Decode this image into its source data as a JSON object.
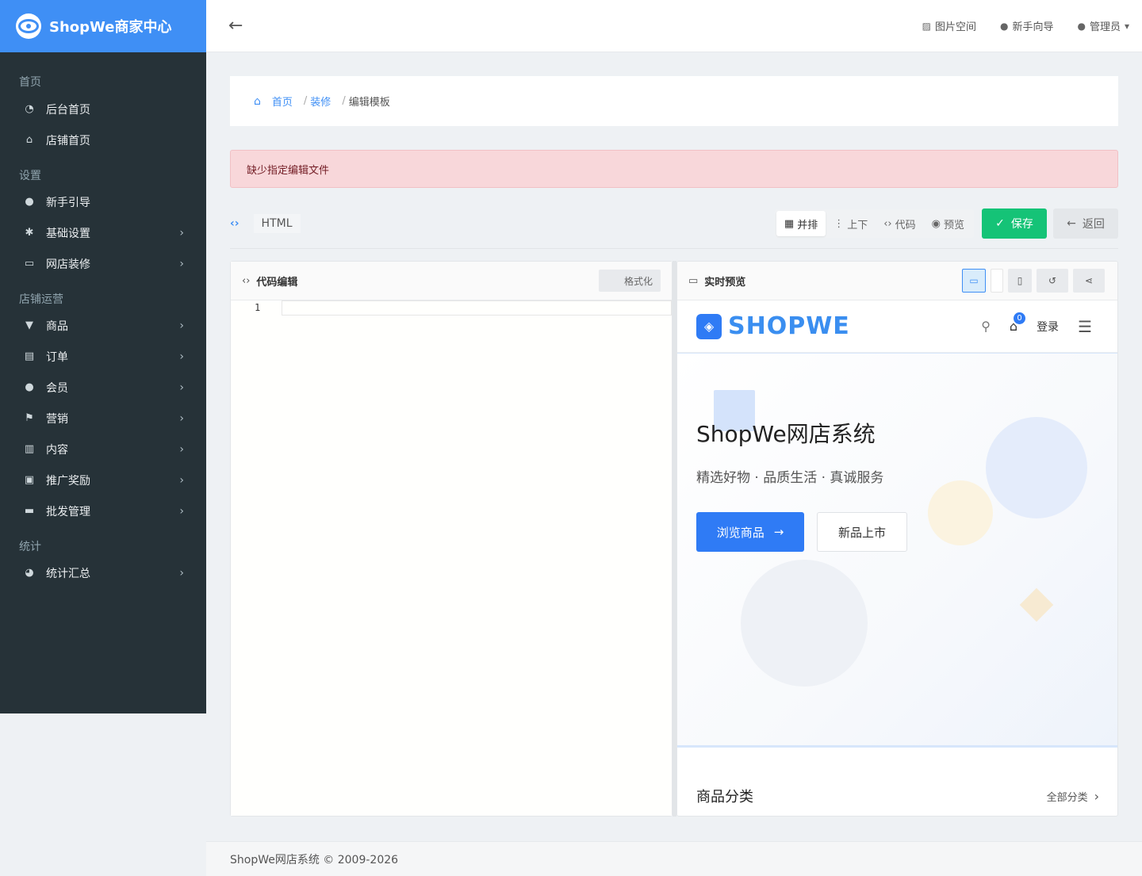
{
  "brand": {
    "name": "ShopWe商家中心"
  },
  "sidebar": {
    "sections": [
      {
        "title": "首页",
        "items": [
          {
            "label": "后台首页",
            "icon": "dashboard-icon",
            "has_arrow": false
          },
          {
            "label": "店铺首页",
            "icon": "home-icon",
            "has_arrow": false
          }
        ]
      },
      {
        "title": "设置",
        "items": [
          {
            "label": "新手引导",
            "icon": "map-marker-icon",
            "has_arrow": false
          },
          {
            "label": "基础设置",
            "icon": "gear-icon",
            "has_arrow": true
          },
          {
            "label": "网店装修",
            "icon": "monitor-icon",
            "has_arrow": true
          }
        ]
      },
      {
        "title": "店铺运营",
        "items": [
          {
            "label": "商品",
            "icon": "cart-icon",
            "has_arrow": true
          },
          {
            "label": "订单",
            "icon": "list-icon",
            "has_arrow": true
          },
          {
            "label": "会员",
            "icon": "user-icon",
            "has_arrow": true
          },
          {
            "label": "营销",
            "icon": "flag-icon",
            "has_arrow": true
          },
          {
            "label": "内容",
            "icon": "book-icon",
            "has_arrow": true
          },
          {
            "label": "推广奖励",
            "icon": "clipboard-icon",
            "has_arrow": true
          },
          {
            "label": "批发管理",
            "icon": "briefcase-icon",
            "has_arrow": true
          }
        ]
      },
      {
        "title": "统计",
        "items": [
          {
            "label": "统计汇总",
            "icon": "pie-chart-icon",
            "has_arrow": true
          }
        ]
      }
    ]
  },
  "header": {
    "image_space": "图片空间",
    "guide": "新手向导",
    "user": "管理员"
  },
  "breadcrumb": {
    "home": "首页",
    "decorate": "装修",
    "current": "编辑模板"
  },
  "alert": {
    "message": "缺少指定编辑文件"
  },
  "toolbar": {
    "file_type": "HTML",
    "layout_side": "并排",
    "layout_stack": "上下",
    "layout_code": "代码",
    "layout_preview": "预览",
    "save": "保存",
    "back": "返回"
  },
  "editor": {
    "title": "代码编辑",
    "format_btn": "格式化",
    "line_number": "1"
  },
  "preview": {
    "title": "实时预览",
    "site": {
      "logo_text": "SHOPWE",
      "cart_count": "0",
      "login": "登录",
      "hero_title": "ShopWe网店系统",
      "hero_subtitle": "精选好物 · 品质生活 · 真诚服务",
      "browse_btn": "浏览商品",
      "new_btn": "新品上市",
      "category_title": "商品分类",
      "category_all": "全部分类"
    }
  },
  "footer": {
    "copyright": "ShopWe网店系统 © 2009-2026"
  },
  "colors": {
    "primary": "#3f8ff5",
    "sidebar_bg": "#263238",
    "save_green": "#15c377",
    "alert_bg": "#f8d7da"
  }
}
